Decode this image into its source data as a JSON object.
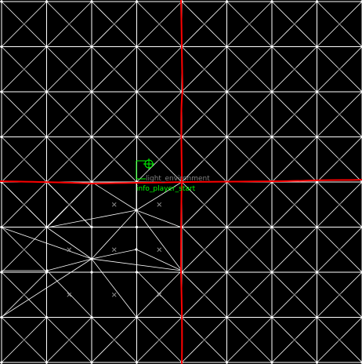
{
  "viewport": {
    "name": "2d-top-view",
    "background_color": "#000000",
    "grid_color": "#ffffff",
    "axis_color": "#ff0000"
  },
  "entities": [
    {
      "id": "light_environment",
      "label": "light_environment",
      "color": "#808080",
      "icon": "light-environment-icon"
    },
    {
      "id": "info_player_start",
      "label": "info_player_start",
      "color": "#00ff00",
      "icon": "player-start-icon"
    }
  ]
}
